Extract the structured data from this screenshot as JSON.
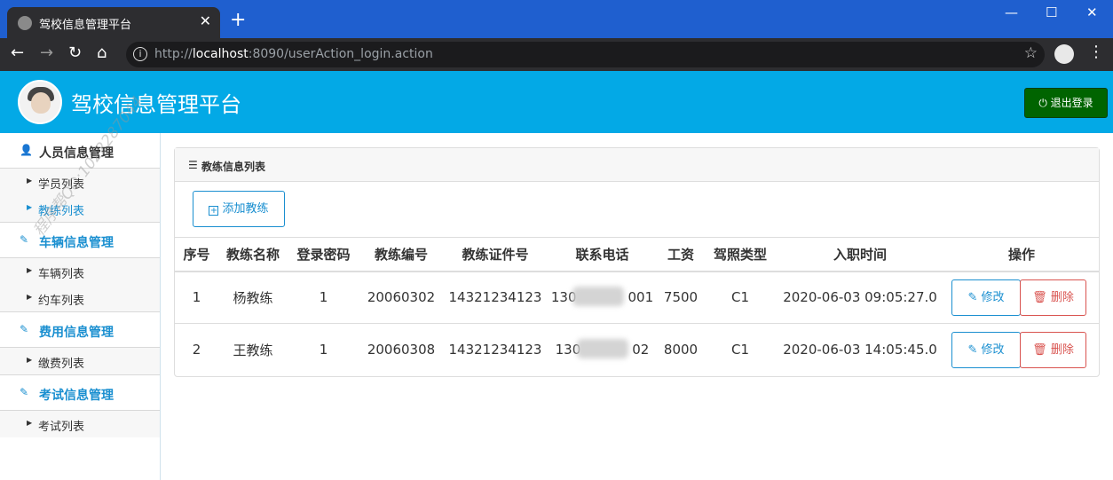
{
  "browser": {
    "tab_title": "驾校信息管理平台",
    "url_prefix": "http://",
    "url_host": "localhost",
    "url_rest": ":8090/userAction_login.action"
  },
  "app": {
    "title": "驾校信息管理平台",
    "logout_label": "退出登录",
    "colors": {
      "header": "#03a9e6",
      "logout": "#006400",
      "accent": "#1a8fd0",
      "danger": "#d9534f"
    }
  },
  "sidebar": {
    "groups": [
      {
        "label": "人员信息管理",
        "icon": "user-icon",
        "items": [
          {
            "label": "学员列表",
            "active": false
          },
          {
            "label": "教练列表",
            "active": true
          }
        ]
      },
      {
        "label": "车辆信息管理",
        "icon": "edit-icon",
        "items": [
          {
            "label": "车辆列表",
            "active": false
          },
          {
            "label": "约车列表",
            "active": false
          }
        ]
      },
      {
        "label": "费用信息管理",
        "icon": "edit-icon",
        "items": [
          {
            "label": "缴费列表",
            "active": false
          }
        ]
      },
      {
        "label": "考试信息管理",
        "icon": "edit-icon",
        "items": [
          {
            "label": "考试列表",
            "active": false
          }
        ]
      }
    ]
  },
  "watermark": "程序帮QQ:1022287044",
  "panel": {
    "title": "教练信息列表",
    "add_label": "添加教练"
  },
  "table": {
    "headers": [
      "序号",
      "教练名称",
      "登录密码",
      "教练编号",
      "教练证件号",
      "联系电话",
      "工资",
      "驾照类型",
      "入职时间",
      "操作"
    ],
    "rows": [
      {
        "no": "1",
        "name": "杨教练",
        "password": "1",
        "code": "20060302",
        "cert": "14321234123",
        "phone_start": "130",
        "phone_end": "001",
        "salary": "7500",
        "license": "C1",
        "hired": "2020-06-03 09:05:27.0"
      },
      {
        "no": "2",
        "name": "王教练",
        "password": "1",
        "code": "20060308",
        "cert": "14321234123",
        "phone_start": "130",
        "phone_end": "02",
        "salary": "8000",
        "license": "C1",
        "hired": "2020-06-03 14:05:45.0"
      }
    ],
    "edit_label": "修改",
    "delete_label": "删除"
  }
}
